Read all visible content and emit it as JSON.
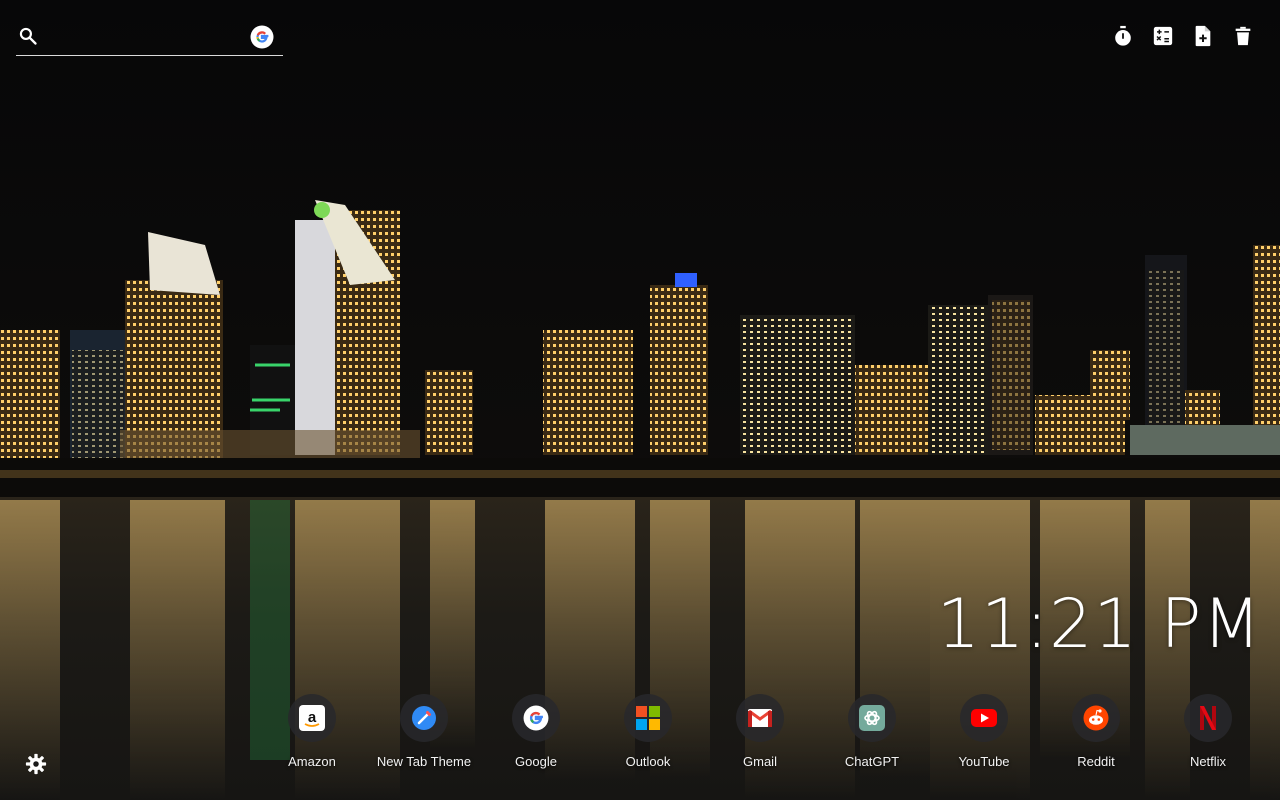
{
  "search": {
    "placeholder": "",
    "value": "",
    "engine_icon": "google-g-icon"
  },
  "toolbar": [
    "stopwatch-icon",
    "calculator-icon",
    "add-note-icon",
    "trash-icon"
  ],
  "clock": {
    "time": "11:21 PM"
  },
  "shortcuts": [
    {
      "label": "Amazon",
      "icon": "amazon-icon"
    },
    {
      "label": "New Tab Theme",
      "icon": "new-tab-theme-icon"
    },
    {
      "label": "Google",
      "icon": "google-icon"
    },
    {
      "label": "Outlook",
      "icon": "outlook-icon"
    },
    {
      "label": "Gmail",
      "icon": "gmail-icon"
    },
    {
      "label": "ChatGPT",
      "icon": "chatgpt-icon"
    },
    {
      "label": "YouTube",
      "icon": "youtube-icon"
    },
    {
      "label": "Reddit",
      "icon": "reddit-icon"
    },
    {
      "label": "Netflix",
      "icon": "netflix-icon"
    }
  ],
  "settings_icon": "gear-icon",
  "background": "night-city-skyline-over-water"
}
